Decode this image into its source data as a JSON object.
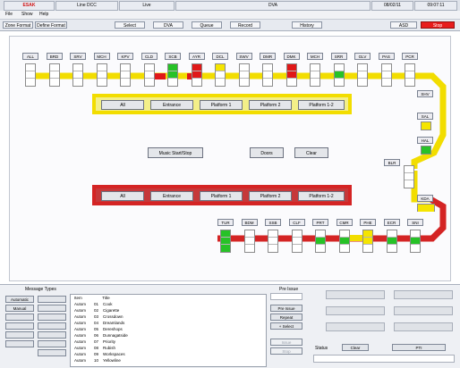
{
  "topbar": {
    "cells": [
      "ESAK",
      "Line DCC",
      "Live",
      "DVA",
      "08/02/11",
      "09:07:11"
    ]
  },
  "menu": [
    "File",
    "Show",
    "Help"
  ],
  "toolbar": {
    "left": [
      "Zone Format",
      "Define Format"
    ],
    "center": [
      "Select",
      "DVA",
      "Queue",
      "Record"
    ],
    "history": "History",
    "right": [
      "ASD",
      "Stop"
    ]
  },
  "signals_top": {
    "labels": [
      "ALL",
      "BRD",
      "SRV",
      "MCH",
      "KPV",
      "CLD",
      "SCB",
      "AYR",
      "DCL",
      "SWV",
      "DMR",
      "DMK",
      "MCH",
      "SRR",
      "GLV",
      "PAS",
      "PCR"
    ],
    "lamps": [
      [
        "",
        "",
        ""
      ],
      [
        "",
        "",
        ""
      ],
      [
        "",
        "",
        ""
      ],
      [
        "",
        "",
        ""
      ],
      [
        "",
        "",
        ""
      ],
      [
        "",
        "",
        ""
      ],
      [
        "g",
        "g",
        ""
      ],
      [
        "r",
        "r",
        ""
      ],
      [
        "y",
        "",
        ""
      ],
      [
        "",
        "",
        ""
      ],
      [
        "",
        "",
        ""
      ],
      [
        "r",
        "r",
        ""
      ],
      [
        "",
        "",
        ""
      ],
      [
        "",
        "g",
        ""
      ],
      [
        "",
        "",
        ""
      ],
      [
        "",
        "",
        ""
      ],
      [
        "",
        "",
        ""
      ]
    ]
  },
  "signals_right": {
    "labels": [
      "SHV",
      "SAL",
      "HAL",
      "KDA",
      "BLR"
    ]
  },
  "signals_bottom": {
    "labels": [
      "TUR",
      "BDM",
      "SSB",
      "CLF",
      "PRT",
      "CMR",
      "PHE",
      "ECR",
      "SNI"
    ],
    "lamps": [
      [
        "g",
        "g",
        "g"
      ],
      [
        "",
        "",
        ""
      ],
      [
        "",
        "",
        ""
      ],
      [
        "",
        "",
        ""
      ],
      [
        "",
        "g",
        ""
      ],
      [
        "",
        "g",
        ""
      ],
      [
        "y",
        "y",
        ""
      ],
      [
        "",
        "g",
        ""
      ],
      [
        "",
        "g",
        ""
      ]
    ]
  },
  "platform_yellow": [
    "All",
    "Entrance",
    "Platform 1",
    "Platform 2",
    "Platform 1-2"
  ],
  "platform_red": [
    "All",
    "Entrance",
    "Platform 1",
    "Platform 2",
    "Platform 1-2"
  ],
  "mid_buttons": {
    "music": "Music Start/Stop",
    "doors": "Doors",
    "clear": "Clear"
  },
  "bottom": {
    "message_types_title": "Message Types",
    "msg_buttons": [
      "Automatic",
      "Manual",
      "",
      "",
      "",
      "",
      "",
      "",
      ""
    ],
    "list_headers": [
      "Item",
      "Title"
    ],
    "list_rows": [
      [
        "Autom",
        "01",
        "Cook"
      ],
      [
        "Autom",
        "02",
        "Cigarette"
      ],
      [
        "Autom",
        "03",
        "Crossdown"
      ],
      [
        "Autom",
        "04",
        "Dreamlands"
      ],
      [
        "Autom",
        "05",
        "Dereshops"
      ],
      [
        "Autom",
        "06",
        "Dunnagatside"
      ],
      [
        "Autom",
        "07",
        "Priority"
      ],
      [
        "Autom",
        "08",
        "Rubish"
      ],
      [
        "Autom",
        "09",
        "Workspaces"
      ],
      [
        "Autom",
        "10",
        "Yellowline"
      ]
    ],
    "pre_issue_title": "Pre Issue",
    "right_buttons": [
      "Pre Issue",
      "Repeat",
      "+ Select"
    ],
    "dim_buttons": [
      "Issue",
      "Stop"
    ],
    "status_label": "Status",
    "status_value": "Clear",
    "pti": "PTI"
  }
}
